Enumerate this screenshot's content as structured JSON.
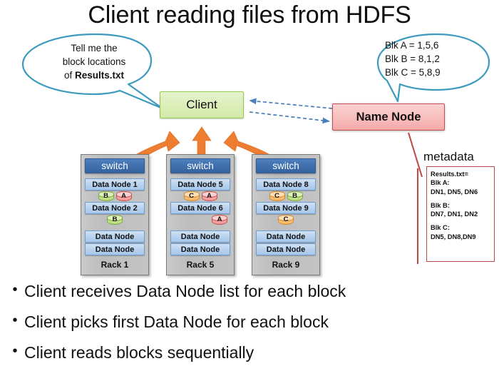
{
  "slide": {
    "title": "Client reading files from HDFS"
  },
  "bubbles": {
    "client_request": {
      "line1": "Tell me the",
      "line2": "block locations",
      "line3_prefix": "of ",
      "line3_bold": "Results.txt"
    },
    "namenode_reply": {
      "line1": "Blk A = 1,5,6",
      "line2": "Blk B = 8,1,2",
      "line3": "Blk C = 5,8,9"
    }
  },
  "nodes": {
    "client_label": "Client",
    "namenode_label": "Name Node"
  },
  "racks": [
    {
      "switch_label": "switch",
      "rack_label": "Rack 1",
      "datanodes": [
        {
          "label": "Data Node 1",
          "blocks": [
            {
              "label": "B",
              "color": "green"
            },
            {
              "label": "A",
              "color": "red"
            }
          ]
        },
        {
          "label": "Data Node 2",
          "blocks": [
            {
              "label": "B",
              "color": "green"
            }
          ]
        },
        {
          "label": "Data Node",
          "blocks": []
        },
        {
          "label": "Data Node",
          "blocks": []
        }
      ]
    },
    {
      "switch_label": "switch",
      "rack_label": "Rack 5",
      "datanodes": [
        {
          "label": "Data Node 5",
          "blocks": [
            {
              "label": "C",
              "color": "orange"
            },
            {
              "label": "A",
              "color": "red"
            }
          ]
        },
        {
          "label": "Data Node 6",
          "blocks": [
            {
              "label": "A",
              "color": "red"
            }
          ]
        },
        {
          "label": "Data Node",
          "blocks": []
        },
        {
          "label": "Data Node",
          "blocks": []
        }
      ]
    },
    {
      "switch_label": "switch",
      "rack_label": "Rack 9",
      "datanodes": [
        {
          "label": "Data Node 8",
          "blocks": [
            {
              "label": "C",
              "color": "orange"
            },
            {
              "label": "B",
              "color": "green"
            }
          ]
        },
        {
          "label": "Data Node 9",
          "blocks": [
            {
              "label": "C",
              "color": "orange"
            }
          ]
        },
        {
          "label": "Data Node",
          "blocks": []
        },
        {
          "label": "Data Node",
          "blocks": []
        }
      ]
    }
  ],
  "metadata": {
    "title": "metadata",
    "file_line": "Results.txt=",
    "entries": [
      {
        "block": "Blk A:",
        "nodes": "DN1, DN5, DN6"
      },
      {
        "block": "Blk B:",
        "nodes": "DN7, DN1, DN2"
      },
      {
        "block": "Blk C:",
        "nodes": "DN5, DN8,DN9"
      }
    ]
  },
  "bullets": [
    "Client receives Data Node list for each block",
    "Client picks first Data Node for each block",
    "Client reads blocks sequentially"
  ],
  "bullet_marker": "•",
  "colors": {
    "bubble_stroke": "#3c9bbd",
    "client_fill": "#d9ecb5",
    "client_stroke": "#94c84a",
    "namenode_fill": "#f8bdbd",
    "namenode_stroke": "#c0504d",
    "switch_fill": "#4f81bd",
    "datanode_fill": "#b9d3ef",
    "rack_fill": "#c2c2c2",
    "data_arrow": "#ed7d31",
    "control_arrow": "#4a7ebb",
    "metadata_stroke": "#be4b48",
    "block_green": "#b9dd7e",
    "block_red": "#f29a9a",
    "block_orange": "#f8b865"
  }
}
